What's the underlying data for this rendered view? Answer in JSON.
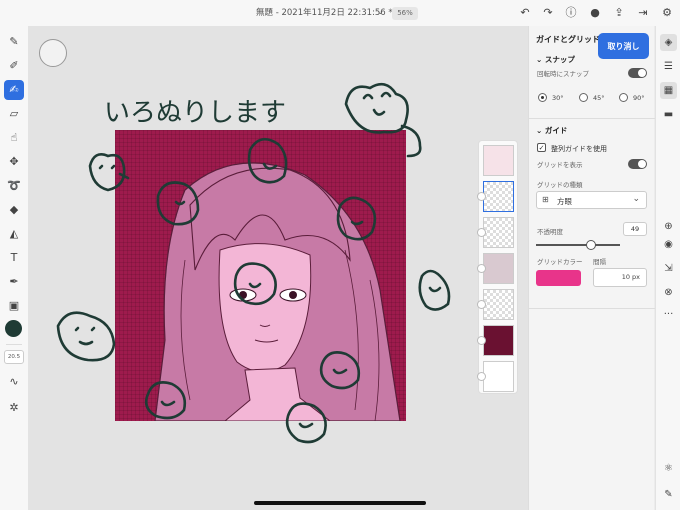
{
  "topbar": {
    "doc_title": "無題 - 2021年11月2日 22:31:56 *",
    "zoom": "56%",
    "icons": [
      "undo-icon",
      "redo-icon",
      "help-icon",
      "account-icon",
      "share-icon",
      "export-icon",
      "settings-icon"
    ]
  },
  "tools": {
    "items": [
      "brush-icon",
      "pencil-icon",
      "paint-brush-icon",
      "eraser-icon",
      "smudge-icon",
      "move-icon",
      "lasso-icon",
      "fill-icon",
      "shape-icon",
      "text-icon",
      "eyedropper-icon",
      "image-icon"
    ],
    "active": "paint-brush-icon",
    "brush_size": "20.5",
    "current_color": "#1f3b35"
  },
  "canvas": {
    "handwriting": "いろぬりします",
    "artwork_color": "#9e1b4d",
    "doodle_color": "#1f3b35"
  },
  "panel": {
    "title": "ガイドとグリッド",
    "cancel_label": "取り消し",
    "snap": {
      "heading": "スナップ",
      "rotate_label": "回転時にスナップ",
      "angles": [
        "30°",
        "45°",
        "90°"
      ],
      "selected_angle": "30°"
    },
    "guide": {
      "heading": "ガイド",
      "align_label": "整列ガイドを使用",
      "show_grid_label": "グリッドを表示",
      "grid_type_label": "グリッドの種類",
      "grid_type_value": "方眼",
      "opacity_label": "不透明度",
      "opacity_value": "49",
      "grid_color_label": "グリッドカラー",
      "spacing_label": "間隔",
      "spacing_value": "10 px",
      "grid_color": "#e8348a"
    }
  },
  "right_icons": [
    "layers-icon",
    "adjust-icon",
    "layer-panel-icon",
    "comment-icon",
    "add-layer-icon",
    "visibility-icon",
    "import-icon",
    "blend-icon",
    "more-icon",
    "properties-icon",
    "edit-icon"
  ]
}
